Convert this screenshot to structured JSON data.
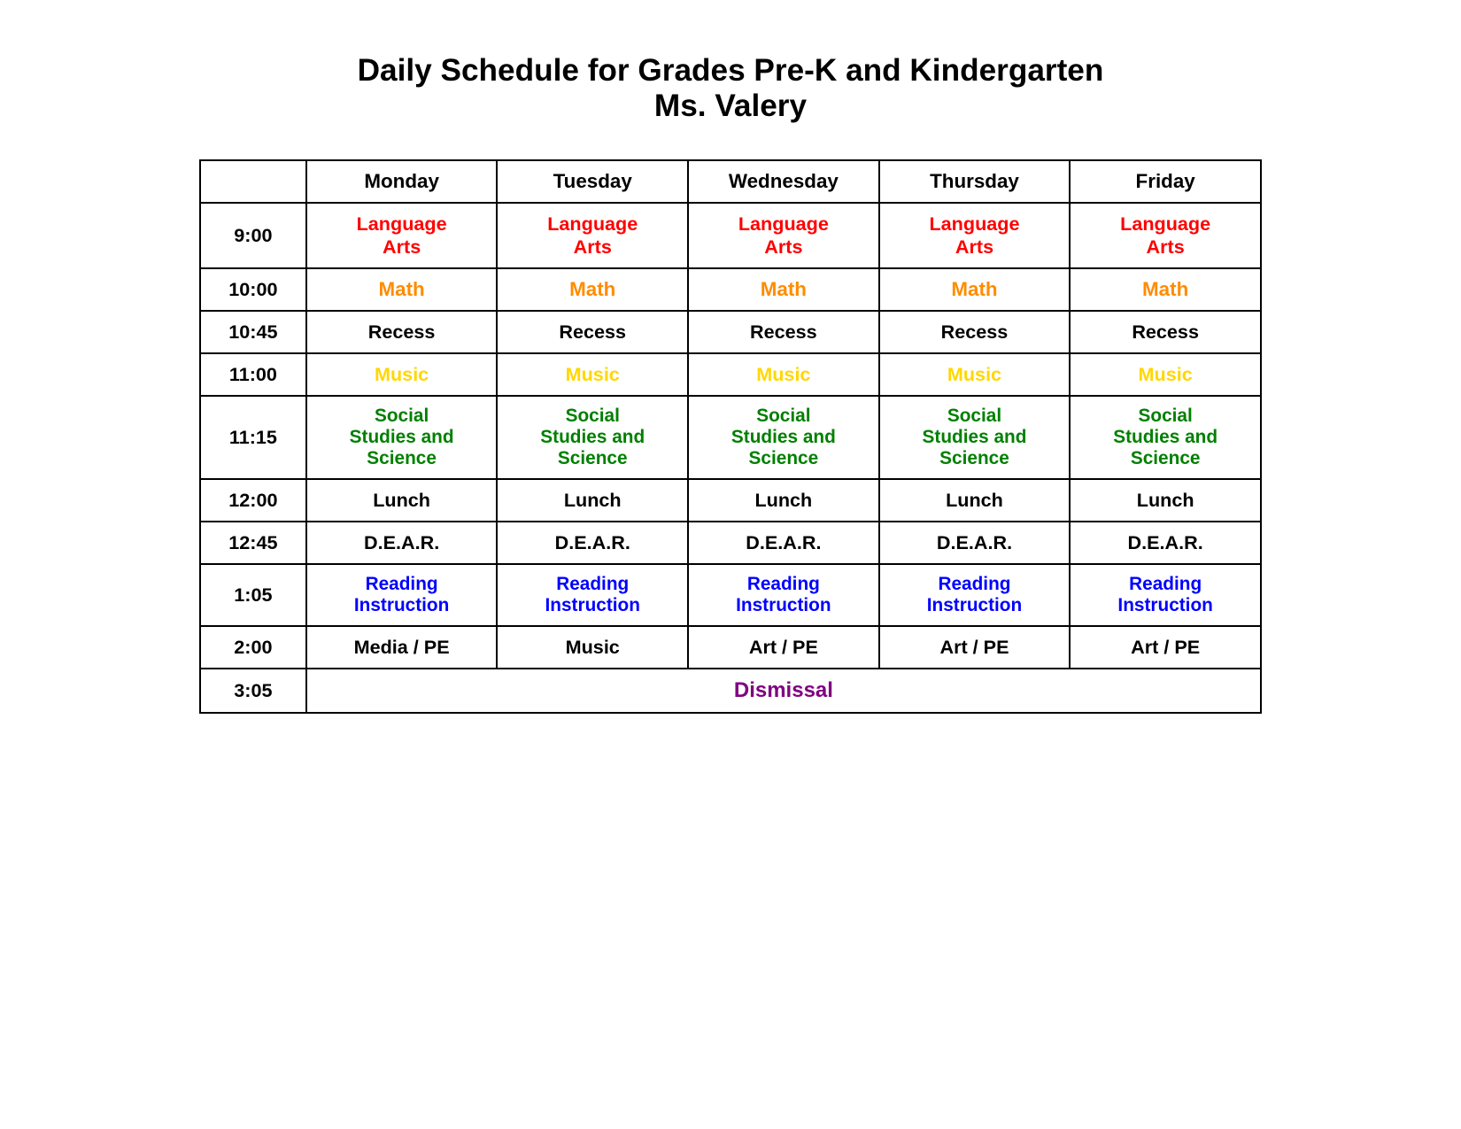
{
  "title": {
    "line1": "Daily Schedule for Grades Pre-K and Kindergarten",
    "line2": "Ms. Valery"
  },
  "headers": {
    "time": "",
    "monday": "Monday",
    "tuesday": "Tuesday",
    "wednesday": "Wednesday",
    "thursday": "Thursday",
    "friday": "Friday"
  },
  "rows": [
    {
      "time": "9:00",
      "monday": "Language Arts",
      "tuesday": "Language Arts",
      "wednesday": "Language Arts",
      "thursday": "Language Arts",
      "friday": "Language Arts",
      "class": "lang-arts"
    },
    {
      "time": "10:00",
      "monday": "Math",
      "tuesday": "Math",
      "wednesday": "Math",
      "thursday": "Math",
      "friday": "Math",
      "class": "math"
    },
    {
      "time": "10:45",
      "monday": "Recess",
      "tuesday": "Recess",
      "wednesday": "Recess",
      "thursday": "Recess",
      "friday": "Recess",
      "class": "recess"
    },
    {
      "time": "11:00",
      "monday": "Music",
      "tuesday": "Music",
      "wednesday": "Music",
      "thursday": "Music",
      "friday": "Music",
      "class": "music"
    },
    {
      "time": "11:15",
      "monday": "Social Studies and Science",
      "tuesday": "Social Studies and Science",
      "wednesday": "Social Studies and Science",
      "thursday": "Social Studies and Science",
      "friday": "Social Studies and Science",
      "class": "social"
    },
    {
      "time": "12:00",
      "monday": "Lunch",
      "tuesday": "Lunch",
      "wednesday": "Lunch",
      "thursday": "Lunch",
      "friday": "Lunch",
      "class": "lunch"
    },
    {
      "time": "12:45",
      "monday": "D.E.A.R.",
      "tuesday": "D.E.A.R.",
      "wednesday": "D.E.A.R.",
      "thursday": "D.E.A.R.",
      "friday": "D.E.A.R.",
      "class": "dear"
    },
    {
      "time": "1:05",
      "monday": "Reading Instruction",
      "tuesday": "Reading Instruction",
      "wednesday": "Reading Instruction",
      "thursday": "Reading Instruction",
      "friday": "Reading Instruction",
      "class": "reading"
    },
    {
      "time": "2:00",
      "monday": "Media / PE",
      "tuesday": "Music",
      "wednesday": "Art / PE",
      "thursday": "Art / PE",
      "friday": "Art / PE",
      "class": "media-pe"
    },
    {
      "time": "3:05",
      "dismissal": "Dismissal",
      "colspan": 5
    }
  ]
}
